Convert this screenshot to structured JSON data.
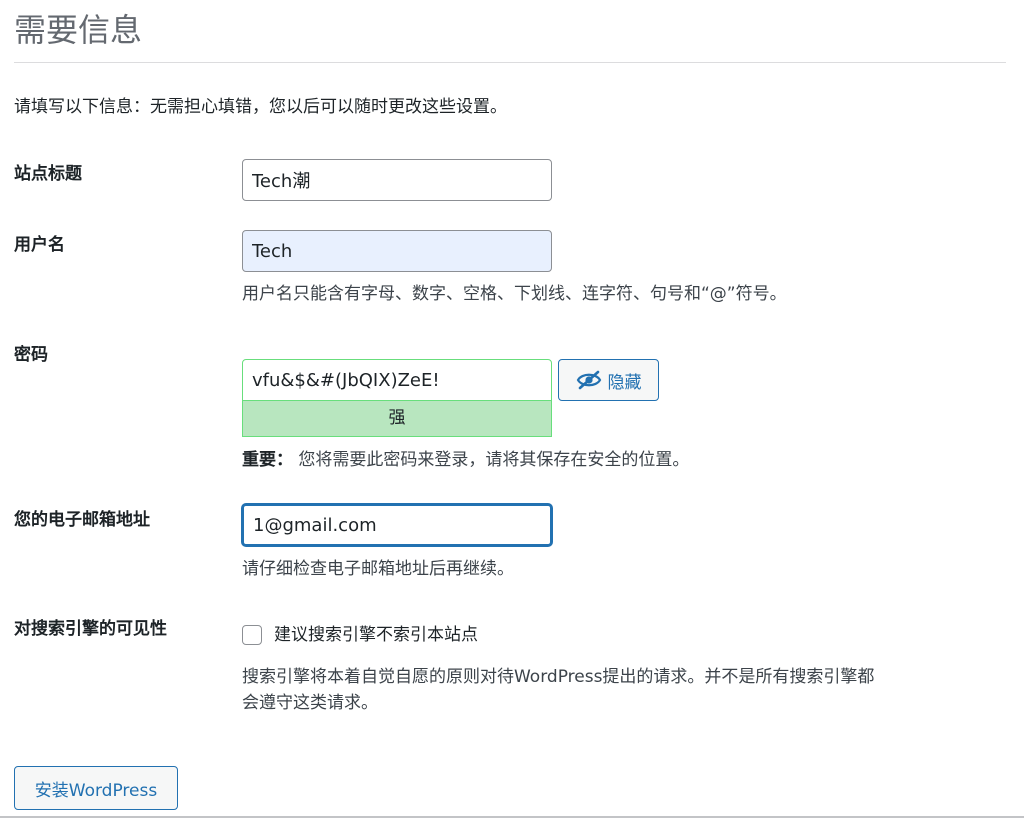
{
  "header": {
    "title": "需要信息"
  },
  "intro": "请填写以下信息：无需担心填错，您以后可以随时更改这些设置。",
  "site_title": {
    "label": "站点标题",
    "value": "Tech潮"
  },
  "username": {
    "label": "用户名",
    "value": "Tech",
    "hint": "用户名只能含有字母、数字、空格、下划线、连字符、句号和“@”符号。"
  },
  "password": {
    "label": "密码",
    "value": "vfu&$&#(JbQIX)ZeE!",
    "strength": "强",
    "hide_button_label": "隐藏",
    "note_strong": "重要：",
    "note_text": "您将需要此密码来登录，请将其保存在安全的位置。"
  },
  "email": {
    "label": "您的电子邮箱地址",
    "value": "1@gmail.com",
    "hint": "请仔细检查电子邮箱地址后再继续。"
  },
  "search_visibility": {
    "label": "对搜索引擎的可见性",
    "checkbox_label": "建议搜索引擎不索引本站点",
    "checked": false,
    "description_line1": "搜索引擎将本着自觉自愿的原则对待WordPress提出的请求。并不是所有搜索引擎都",
    "description_line2": "会遵守这类请求。"
  },
  "install_button_label": "安装WordPress",
  "colors": {
    "accent": "#2271b1",
    "strength_bg": "#b8e6bf",
    "strength_border": "#68de7c"
  },
  "icons": {
    "hide": "eye-slash-icon"
  }
}
